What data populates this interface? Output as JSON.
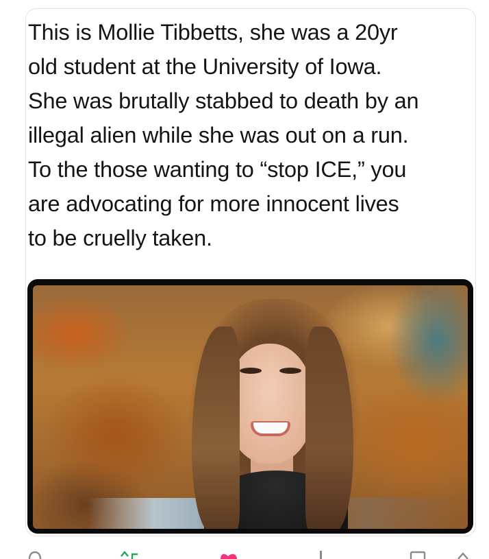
{
  "post": {
    "text": "This is Mollie Tibbetts, she was a 20yr\nold student at the University of Iowa.\nShe was brutally stabbed to death by an\nillegal alien while she was out on a run.\nTo the those wanting to “stop ICE,” you\nare advocating for more innocent lives\nto be cruelly taken."
  },
  "actions": [
    {
      "name": "reply",
      "icon": "reply-icon",
      "color": "#8a8a8a"
    },
    {
      "name": "repost",
      "icon": "repost-icon",
      "color": "#1fa855"
    },
    {
      "name": "like",
      "icon": "heart-icon",
      "color": "#f2357a"
    },
    {
      "name": "views",
      "icon": "views-icon",
      "color": "#8a8a8a"
    },
    {
      "name": "bookmark",
      "icon": "bookmark-icon",
      "color": "#8a8a8a"
    },
    {
      "name": "share",
      "icon": "share-icon",
      "color": "#8a8a8a"
    }
  ]
}
